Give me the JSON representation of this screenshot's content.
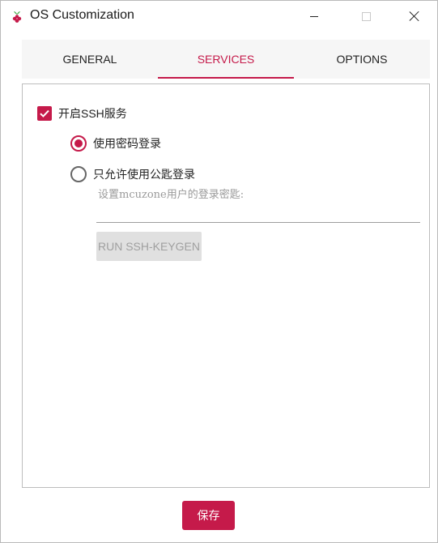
{
  "window": {
    "title": "OS Customization",
    "app_icon": "raspberry-pi-icon"
  },
  "tabs": [
    {
      "label": "GENERAL",
      "active": false
    },
    {
      "label": "SERVICES",
      "active": true
    },
    {
      "label": "OPTIONS",
      "active": false
    }
  ],
  "services": {
    "enable_ssh": {
      "label": "开启SSH服务",
      "checked": true
    },
    "password_login": {
      "label": "使用密码登录",
      "selected": true
    },
    "key_login": {
      "label": "只允许使用公匙登录",
      "selected": false
    },
    "key_hint": "设置mcuzone用户的登录密匙:",
    "key_value": "",
    "keygen_button": "RUN SSH-KEYGEN"
  },
  "footer": {
    "save_label": "保存"
  },
  "colors": {
    "accent": "#c51a4a",
    "tab_bar_bg": "#f6f6f6",
    "disabled_button_bg": "#e0e0e0"
  }
}
